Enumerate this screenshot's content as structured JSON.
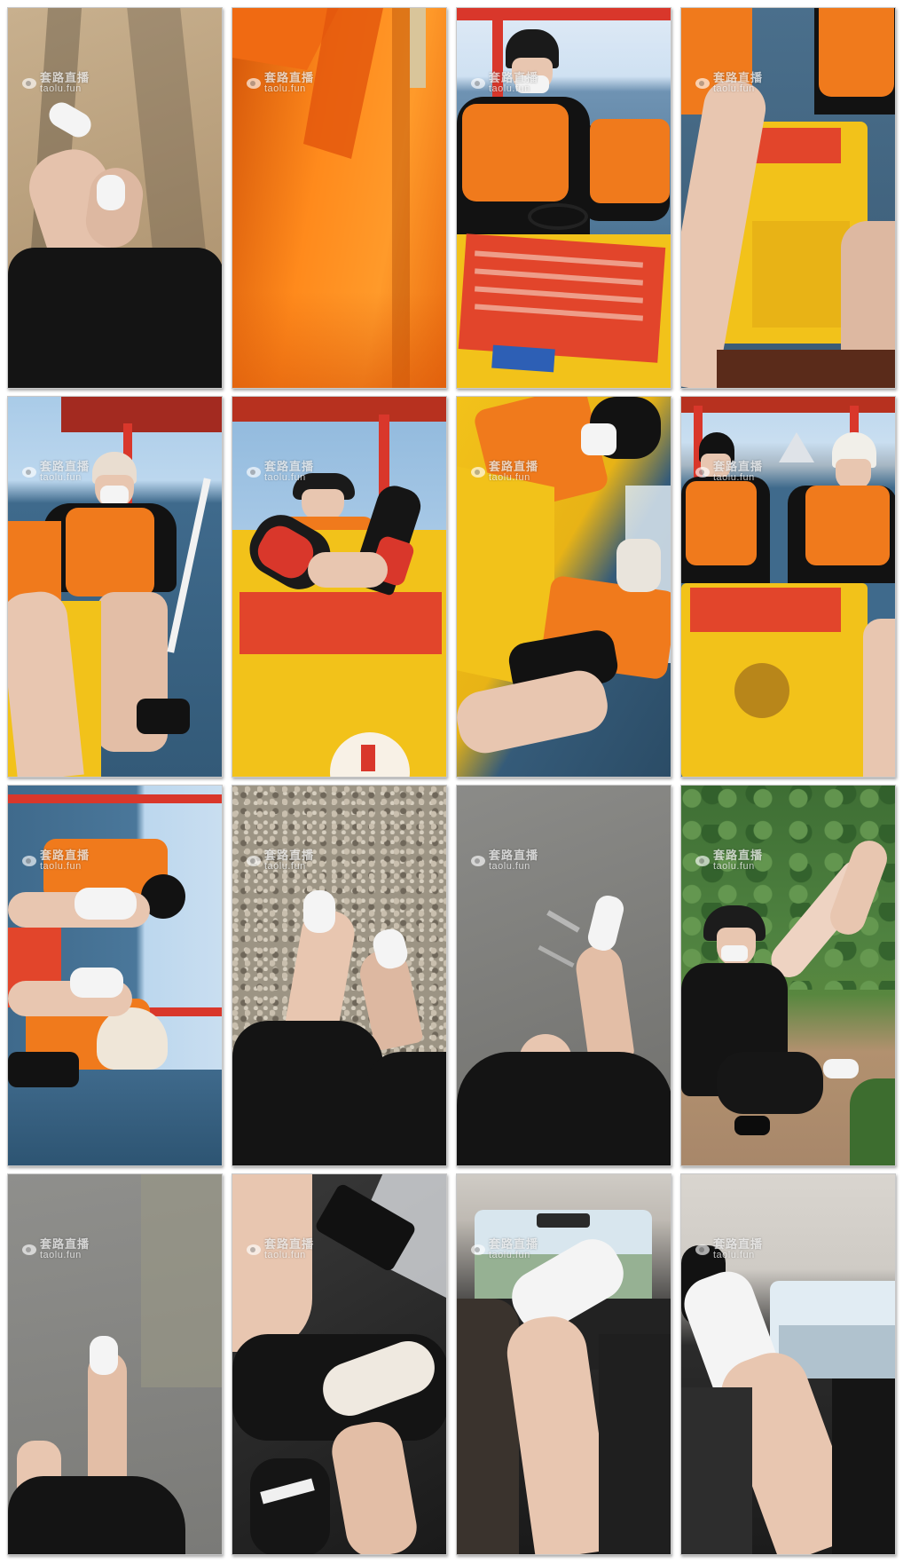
{
  "watermark": {
    "cn": "套路直播",
    "en": "taolu.fun"
  },
  "tiles": [
    {
      "scene": "legs-walking-on-sand"
    },
    {
      "scene": "orange-life-vest-closeup"
    },
    {
      "scene": "man-in-life-vest-on-pedal-boat"
    },
    {
      "scene": "legs-near-yellow-boat-console"
    },
    {
      "scene": "man-in-cap-on-pedal-boat"
    },
    {
      "scene": "man-in-bucket-hat-with-feet-on-console"
    },
    {
      "scene": "tilted-view-boat-passengers"
    },
    {
      "scene": "two-men-in-life-vests-behind-console"
    },
    {
      "scene": "sideways-boat-passengers"
    },
    {
      "scene": "feet-on-gravel-path"
    },
    {
      "scene": "feet-on-asphalt"
    },
    {
      "scene": "man-kneeling-by-bushes"
    },
    {
      "scene": "feet-on-road"
    },
    {
      "scene": "legs-in-car-footwell"
    },
    {
      "scene": "feet-on-car-dashboard"
    },
    {
      "scene": "car-interior-feet-up"
    }
  ],
  "colors": {
    "orange": "#f07a1c",
    "yellow": "#f2c21a",
    "sea": "#3f6a8c",
    "sky": "#bcd7ee",
    "sand": "#b79e7c",
    "skin": "#e8c6b0",
    "black": "#121212",
    "red": "#d9372b",
    "white": "#f4f4f4"
  }
}
